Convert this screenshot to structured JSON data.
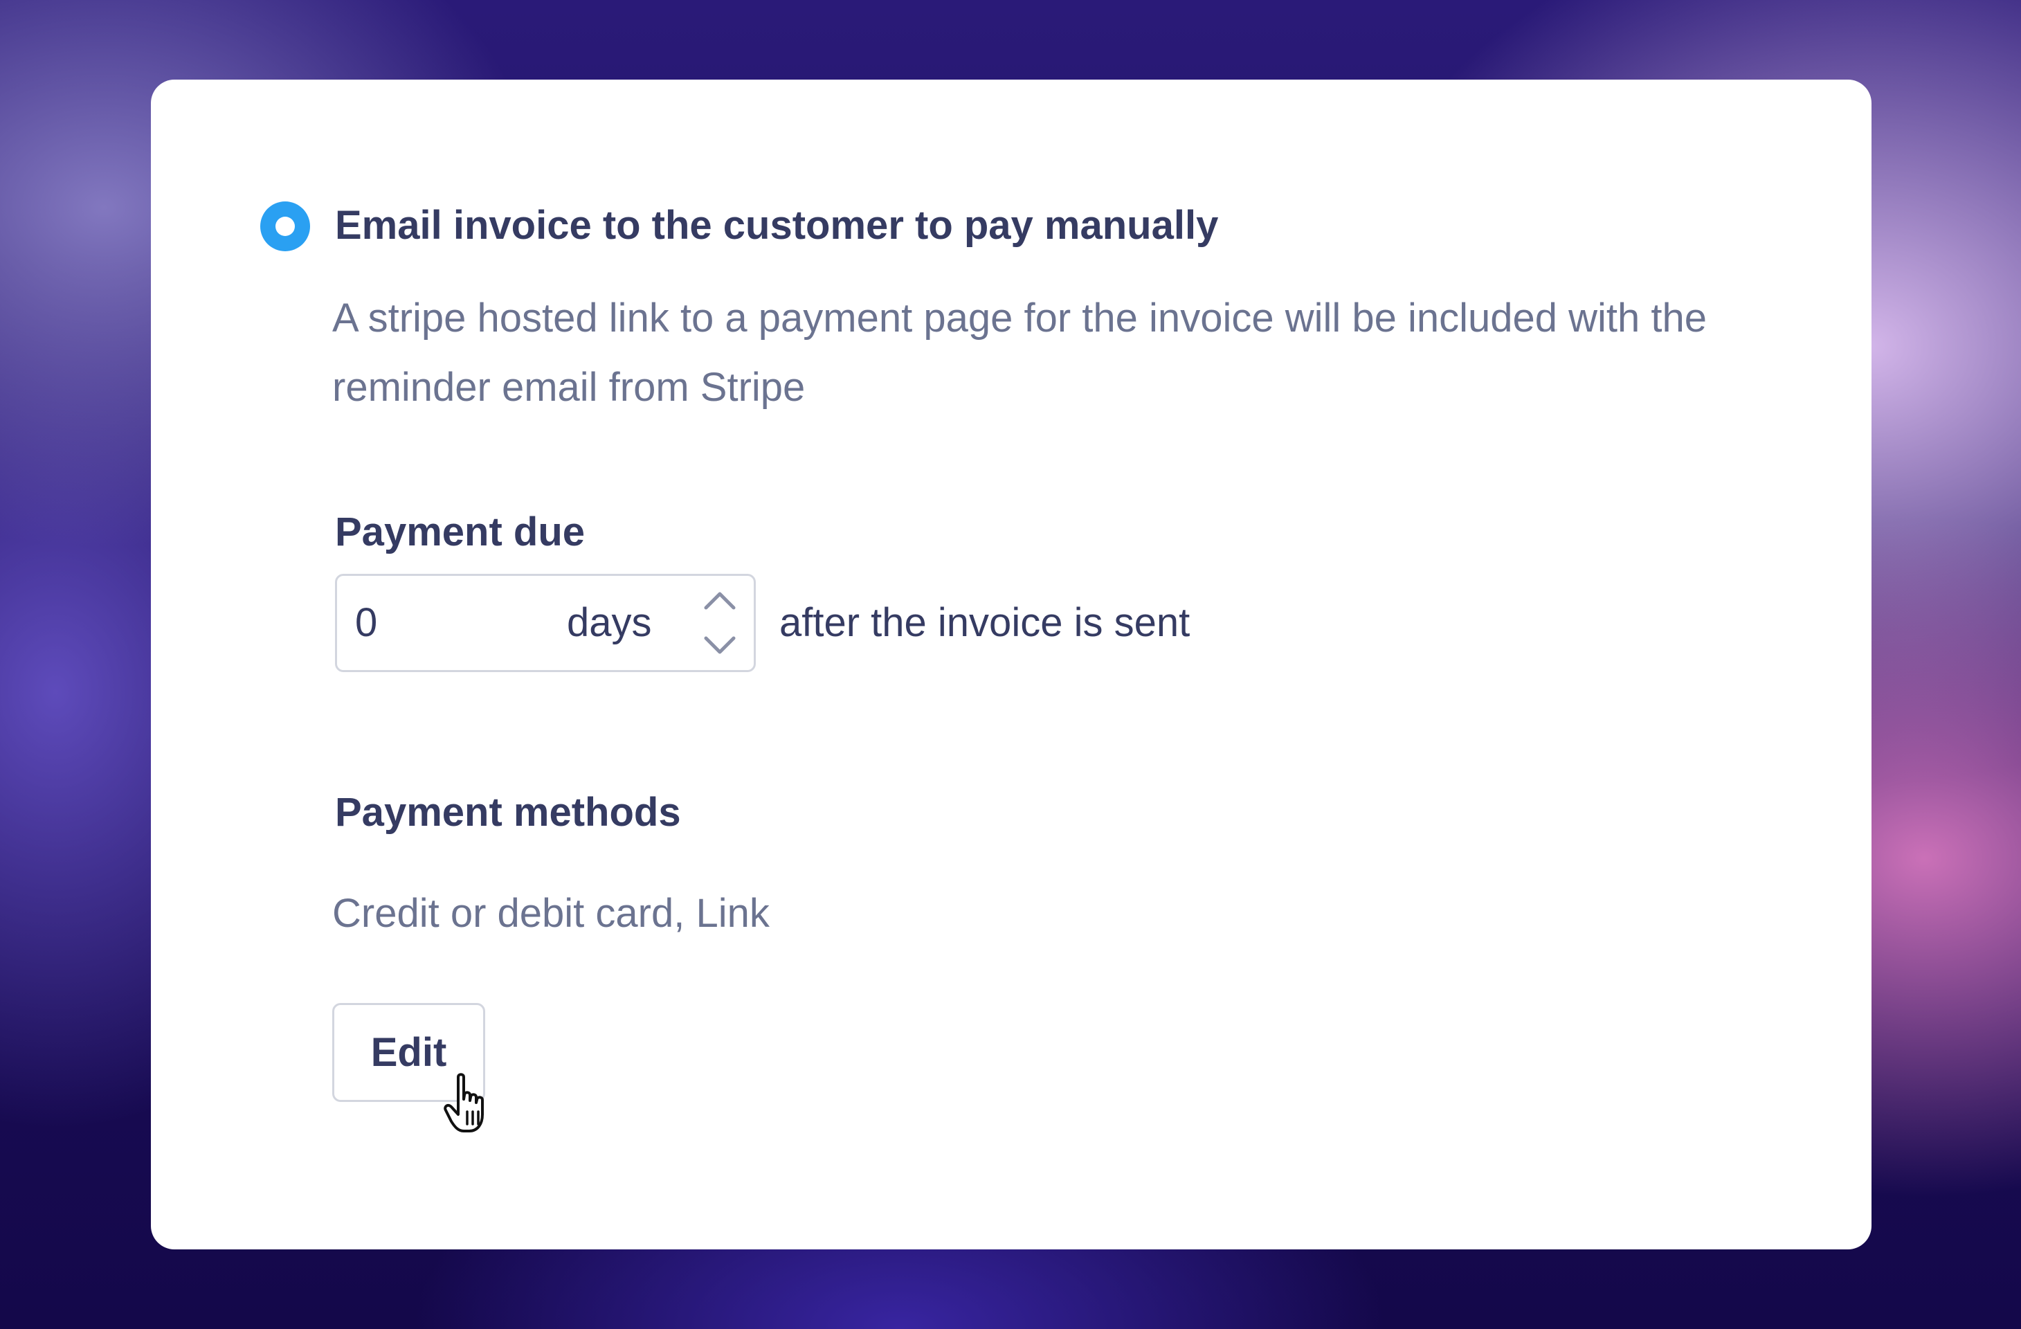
{
  "option": {
    "title": "Email invoice to the customer to pay manually",
    "description": "A stripe hosted link to a payment page for the invoice will be included with the reminder email from Stripe",
    "selected": true
  },
  "payment_due": {
    "label": "Payment due",
    "value": "0",
    "unit": "days",
    "suffix": "after the invoice is sent"
  },
  "payment_methods": {
    "label": "Payment methods",
    "value": "Credit or debit card, Link",
    "edit_label": "Edit"
  },
  "icons": {
    "radio": "radio-selected-icon",
    "stepper_up": "chevron-up-icon",
    "stepper_down": "chevron-down-icon",
    "cursor": "hand-pointer-cursor-icon"
  },
  "colors": {
    "accent": "#2aa0f2",
    "heading": "#353b62",
    "muted": "#6b7390",
    "border": "#d3d6df"
  }
}
